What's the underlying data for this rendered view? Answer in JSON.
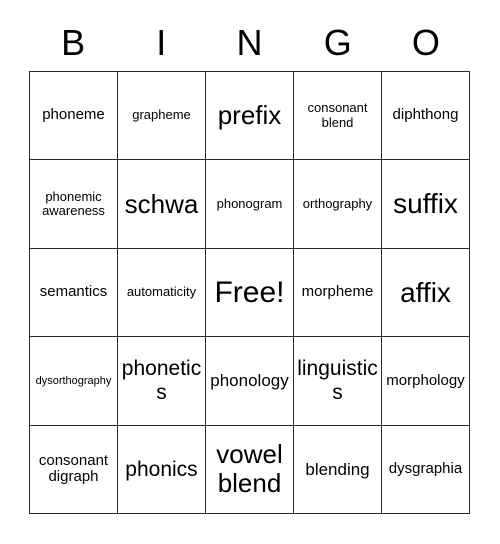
{
  "card": {
    "title": "BINGO",
    "header_letters": [
      "B",
      "I",
      "N",
      "G",
      "O"
    ],
    "free_space_label": "Free!",
    "colors": {
      "grid_line": "#2b2b2b",
      "text": "#000000",
      "background": "#ffffff"
    },
    "rows": [
      [
        {
          "label": "phoneme",
          "size": "md"
        },
        {
          "label": "grapheme",
          "size": "sm"
        },
        {
          "label": "prefix",
          "size": "xxl"
        },
        {
          "label": "consonant blend",
          "size": "sm"
        },
        {
          "label": "diphthong",
          "size": "md"
        }
      ],
      [
        {
          "label": "phonemic awareness",
          "size": "sm"
        },
        {
          "label": "schwa",
          "size": "xxl"
        },
        {
          "label": "phonogram",
          "size": "sm"
        },
        {
          "label": "orthography",
          "size": "sm"
        },
        {
          "label": "suffix",
          "size": "huge"
        }
      ],
      [
        {
          "label": "semantics",
          "size": "md"
        },
        {
          "label": "automaticity",
          "size": "sm"
        },
        {
          "label": "Free!",
          "size": "free"
        },
        {
          "label": "morpheme",
          "size": "md"
        },
        {
          "label": "affix",
          "size": "huge"
        }
      ],
      [
        {
          "label": "dysorthography",
          "size": "xs"
        },
        {
          "label": "phonetics",
          "size": "xl"
        },
        {
          "label": "phonology",
          "size": "lg"
        },
        {
          "label": "linguistics",
          "size": "xl"
        },
        {
          "label": "morphology",
          "size": "md"
        }
      ],
      [
        {
          "label": "consonant digraph",
          "size": "md"
        },
        {
          "label": "phonics",
          "size": "xl"
        },
        {
          "label": "vowel blend",
          "size": "xxl"
        },
        {
          "label": "blending",
          "size": "lg"
        },
        {
          "label": "dysgraphia",
          "size": "md"
        }
      ]
    ]
  }
}
